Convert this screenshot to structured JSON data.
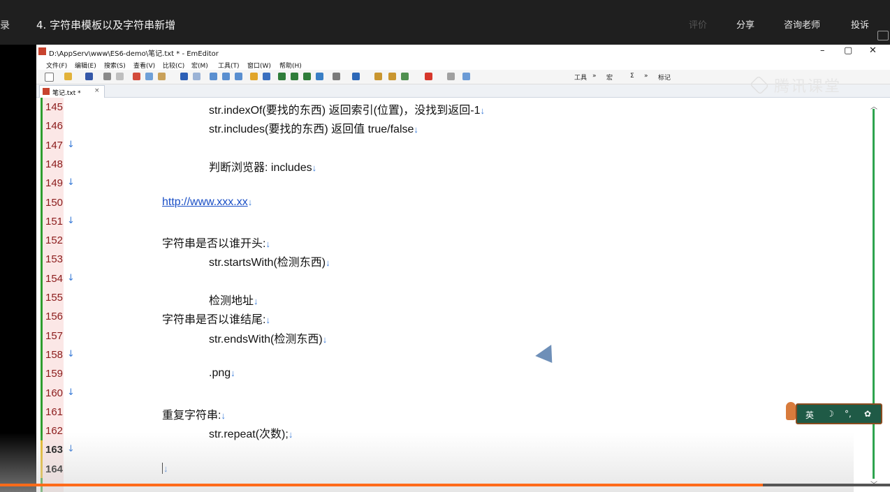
{
  "player": {
    "left_label": "录",
    "lesson_title": "4. 字符串模板以及字符串新增",
    "actions": {
      "rate": "评价",
      "share": "分享",
      "consult": "咨询老师",
      "report": "投诉"
    },
    "progress_fraction": 0.857
  },
  "editor": {
    "caption": "D:\\AppServ\\www\\ES6-demo\\笔记.txt * - EmEditor",
    "window_buttons": {
      "minimize": "–",
      "restore": "▢",
      "close": "✕"
    },
    "menu": [
      "文件(F)",
      "编辑(E)",
      "搜索(S)",
      "查看(V)",
      "比较(C)",
      "宏(M)",
      "工具(T)",
      "窗口(W)",
      "帮助(H)"
    ],
    "toolbar_right": {
      "tools": "工具",
      "sep1": "»",
      "macro": "宏",
      "sigma": "Σ",
      "sep2": "»",
      "bookmark": "标记"
    },
    "tab": {
      "label": "笔记.txt *",
      "close": "×"
    },
    "watermark": "腾讯课堂",
    "arrow_glyph": "↓",
    "lines": [
      {
        "num": "145",
        "text": "str.indexOf(要找的东西)   返回索引(位置)，没找到返回-1",
        "indent": 2
      },
      {
        "num": "146",
        "text": "str.includes(要找的东西)   返回值  true/false",
        "indent": 2
      },
      {
        "num": "147",
        "text": "",
        "indent": 0
      },
      {
        "num": "148",
        "text": "判断浏览器:  includes",
        "indent": 2
      },
      {
        "num": "149",
        "text": "",
        "indent": 0
      },
      {
        "num": "150",
        "text": "http://www.xxx.xx",
        "indent": 1,
        "link": true
      },
      {
        "num": "151",
        "text": "",
        "indent": 0
      },
      {
        "num": "152",
        "text": "字符串是否以谁开头:",
        "indent": 1
      },
      {
        "num": "153",
        "text": "str.startsWith(检测东西)",
        "indent": 2
      },
      {
        "num": "154",
        "text": "",
        "indent": 0
      },
      {
        "num": "155",
        "text": "检测地址",
        "indent": 2
      },
      {
        "num": "156",
        "text": "字符串是否以谁结尾:",
        "indent": 1
      },
      {
        "num": "157",
        "text": "str.endsWith(检测东西)",
        "indent": 2
      },
      {
        "num": "158",
        "text": "",
        "indent": 0
      },
      {
        "num": "159",
        "text": ".png",
        "indent": 2
      },
      {
        "num": "160",
        "text": "",
        "indent": 0
      },
      {
        "num": "161",
        "text": "重复字符串:",
        "indent": 1
      },
      {
        "num": "162",
        "text": "str.repeat(次数);",
        "indent": 2
      },
      {
        "num": "163",
        "text": "",
        "indent": 0,
        "current": true
      },
      {
        "num": "164",
        "text": "",
        "indent": 1,
        "current": true,
        "caret": true
      }
    ]
  },
  "ime": {
    "lang": "英",
    "moon": "☽",
    "punct": "°,",
    "settings": "✿"
  }
}
